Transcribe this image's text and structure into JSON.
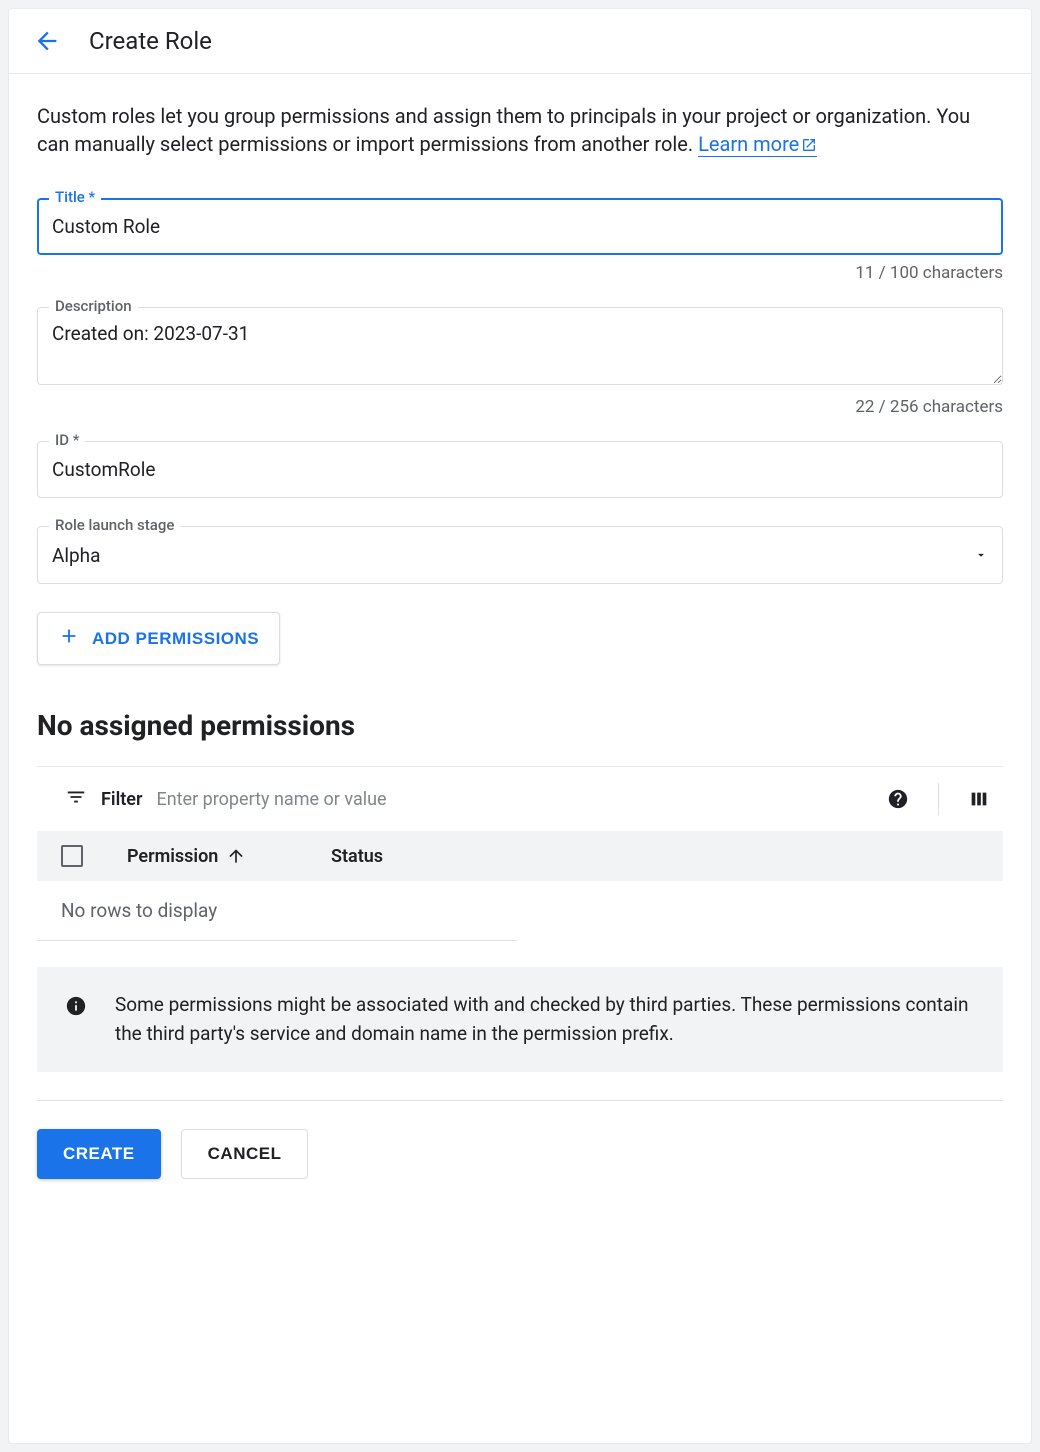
{
  "header": {
    "title": "Create Role"
  },
  "intro": {
    "text": "Custom roles let you group permissions and assign them to principals in your project or organization. You can manually select permissions or import permissions from another role. ",
    "learn_more": "Learn more"
  },
  "fields": {
    "title": {
      "label": "Title *",
      "value": "Custom Role",
      "counter": "11 / 100 characters"
    },
    "description": {
      "label": "Description",
      "value": "Created on: 2023-07-31",
      "counter": "22 / 256 characters"
    },
    "id": {
      "label": "ID *",
      "value": "CustomRole"
    },
    "stage": {
      "label": "Role launch stage",
      "value": "Alpha"
    }
  },
  "add_permissions_label": "ADD PERMISSIONS",
  "permissions_section_title": "No assigned permissions",
  "filter": {
    "label": "Filter",
    "placeholder": "Enter property name or value"
  },
  "table": {
    "col_permission": "Permission",
    "col_status": "Status",
    "empty": "No rows to display"
  },
  "info_text": "Some permissions might be associated with and checked by third parties. These permissions contain the third party's service and domain name in the permission prefix.",
  "actions": {
    "create": "CREATE",
    "cancel": "CANCEL"
  }
}
